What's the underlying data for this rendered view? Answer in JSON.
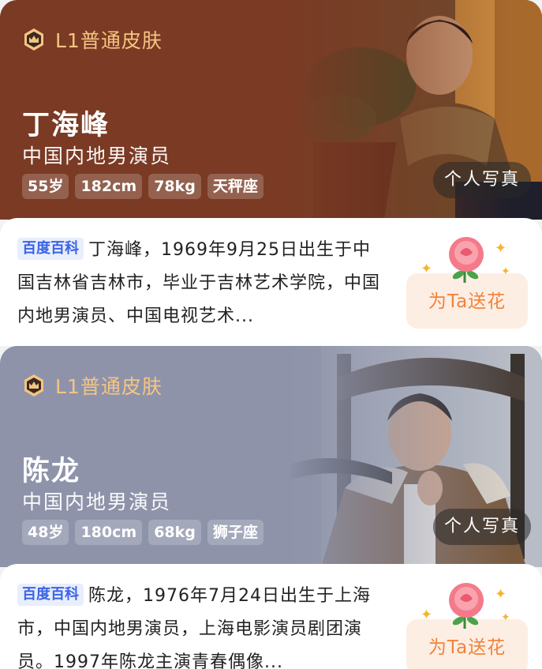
{
  "cards": [
    {
      "skin_label": "L1普通皮肤",
      "name": "丁海峰",
      "occupation": "中国内地男演员",
      "tags": [
        "55岁",
        "182cm",
        "78kg",
        "天秤座"
      ],
      "photo_button": "个人写真",
      "source_badge": "百度百科",
      "description": "丁海峰，1969年9月25日出生于中国吉林省吉林市，毕业于吉林艺术学院，中国内地男演员、中国电视艺术...",
      "gift_button": "为Ta送花"
    },
    {
      "skin_label": "L1普通皮肤",
      "name": "陈龙",
      "occupation": "中国内地男演员",
      "tags": [
        "48岁",
        "180cm",
        "68kg",
        "狮子座"
      ],
      "photo_button": "个人写真",
      "source_badge": "百度百科",
      "description": "陈龙，1976年7月24日出生于上海市，中国内地男演员，上海电影演员剧团演员。1997年陈龙主演青春偶像...",
      "gift_button": "为Ta送花"
    }
  ],
  "colors": {
    "banner_1": "#7a3a24",
    "banner_2": "#8e93aa",
    "skin_gold": "#f5c583",
    "badge_blue": "#3a63e6",
    "gift_orange": "#f0833b"
  },
  "icons": [
    "crown-badge-icon",
    "rose-icon",
    "sparkle-icon"
  ]
}
